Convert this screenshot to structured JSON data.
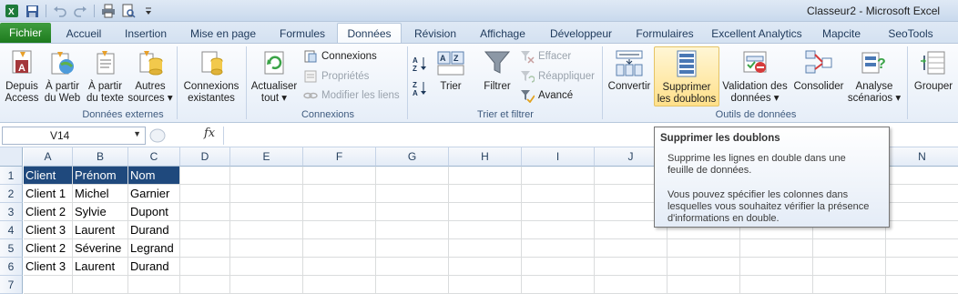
{
  "window": {
    "title": "Classeur2 - Microsoft Excel"
  },
  "qat": {
    "icons": [
      "excel-logo-icon",
      "save-icon",
      "undo-icon",
      "redo-icon",
      "print-icon",
      "print-preview-icon",
      "customize-qat-icon"
    ]
  },
  "tabs": {
    "file": "Fichier",
    "items": [
      "Accueil",
      "Insertion",
      "Mise en page",
      "Formules",
      "Données",
      "Révision",
      "Affichage",
      "Développeur",
      "Formulaires",
      "Excellent Analytics",
      "Mapcite",
      "SeoTools"
    ],
    "active": "Données"
  },
  "ribbon": {
    "external": {
      "label": "Données externes",
      "from_access": [
        "Depuis",
        "Access"
      ],
      "from_web": [
        "À partir",
        "du Web"
      ],
      "from_text": [
        "À partir",
        "du texte"
      ],
      "other": [
        "Autres",
        "sources ▾"
      ],
      "connections": [
        "Connexions",
        "existantes"
      ]
    },
    "connections": {
      "label": "Connexions",
      "refresh": [
        "Actualiser",
        "tout ▾"
      ],
      "connexions": "Connexions",
      "properties": "Propriétés",
      "edit_links": "Modifier les liens"
    },
    "sort": {
      "label": "Trier et filtrer",
      "sort": "Trier",
      "filter": "Filtrer",
      "clear": "Effacer",
      "reapply": "Réappliquer",
      "advanced": "Avancé"
    },
    "tools": {
      "label": "Outils de données",
      "convert": "Convertir",
      "remove_dup": [
        "Supprimer",
        "les doublons"
      ],
      "validation": [
        "Validation des",
        "données ▾"
      ],
      "consolidate": "Consolider",
      "whatif": [
        "Analyse",
        "scénarios ▾"
      ]
    },
    "outline": {
      "group": "Grouper"
    }
  },
  "formula_bar": {
    "name_box": "V14",
    "fx": "fx",
    "value": ""
  },
  "sheet": {
    "columns": [
      "A",
      "B",
      "C",
      "D",
      "E",
      "F",
      "G",
      "H",
      "I",
      "J",
      "K",
      "L",
      "M",
      "N"
    ],
    "rows": [
      "1",
      "2",
      "3",
      "4",
      "5",
      "6",
      "7"
    ],
    "data": [
      [
        "Client",
        "Prénom",
        "Nom"
      ],
      [
        "Client 1",
        "Michel",
        "Garnier"
      ],
      [
        "Client 2",
        "Sylvie",
        "Dupont"
      ],
      [
        "Client 3",
        "Laurent",
        "Durand"
      ],
      [
        "Client 2",
        "Séverine",
        "Legrand"
      ],
      [
        "Client 3",
        "Laurent",
        "Durand"
      ]
    ],
    "header_color": "#1f497d"
  },
  "tooltip": {
    "title": "Supprimer les doublons",
    "text1": [
      "Supprime les lignes en double dans une",
      "feuille de données."
    ],
    "text2": [
      "Vous pouvez spécifier les colonnes dans",
      "lesquelles vous souhaitez vérifier la présence",
      "d'informations en double."
    ]
  },
  "colors": {
    "file_tab": "#2a8a2a",
    "ribbon_highlight": "#ffe08a"
  }
}
